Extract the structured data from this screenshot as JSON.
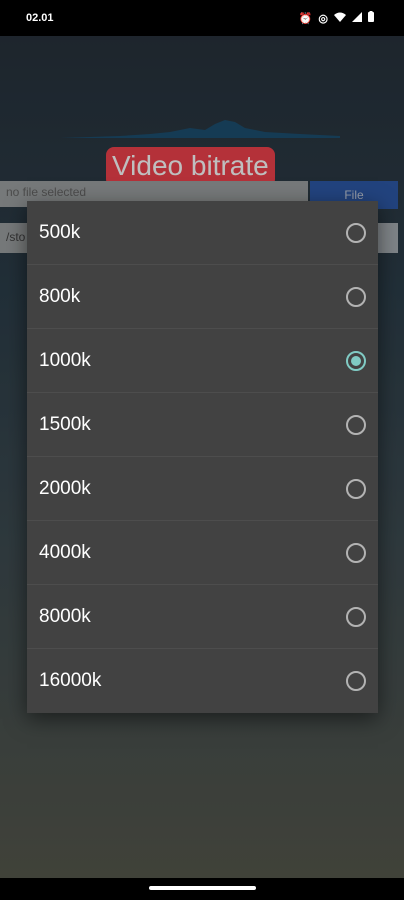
{
  "status_bar": {
    "time": "02.01",
    "icons": [
      "alarm-icon",
      "data-saver-icon",
      "wifi-icon",
      "signal-icon",
      "battery-icon"
    ]
  },
  "app": {
    "title": "Video bitrate",
    "file_input_value": "no file selected",
    "file_button_label": "File",
    "path_input_value": "/sto"
  },
  "dialog": {
    "options": [
      {
        "label": "500k",
        "selected": false
      },
      {
        "label": "800k",
        "selected": false
      },
      {
        "label": "1000k",
        "selected": true
      },
      {
        "label": "1500k",
        "selected": false
      },
      {
        "label": "2000k",
        "selected": false
      },
      {
        "label": "4000k",
        "selected": false
      },
      {
        "label": "8000k",
        "selected": false
      },
      {
        "label": "16000k",
        "selected": false
      }
    ],
    "accent_color": "#80cbc4"
  },
  "colors": {
    "title_badge": "#f0424d",
    "file_button": "#2e5aa8",
    "dialog_bg": "#424242"
  }
}
